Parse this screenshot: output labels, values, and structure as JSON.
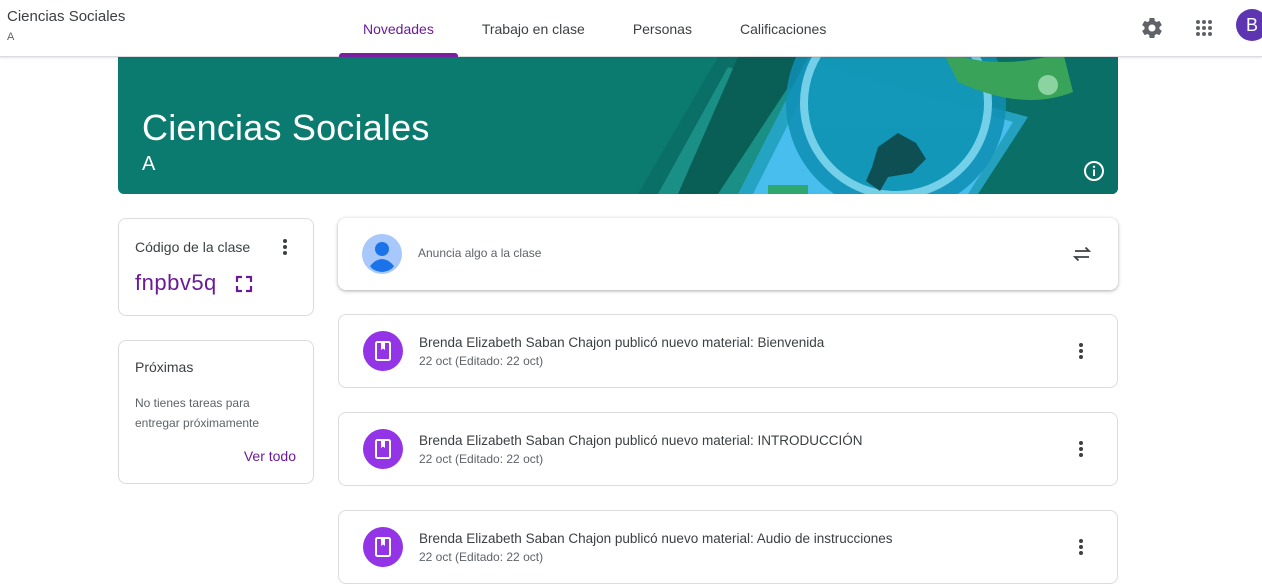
{
  "header": {
    "class_name": "Ciencias Sociales",
    "section": "A",
    "tabs": [
      {
        "label": "Novedades",
        "active": true
      },
      {
        "label": "Trabajo en clase",
        "active": false
      },
      {
        "label": "Personas",
        "active": false
      },
      {
        "label": "Calificaciones",
        "active": false
      }
    ],
    "icons": [
      "settings-icon",
      "apps-grid-icon"
    ],
    "avatar_letter": "B"
  },
  "banner": {
    "title": "Ciencias Sociales",
    "section": "A",
    "color": "#0b7a6f"
  },
  "class_code": {
    "label": "Código de la clase",
    "code": "fnpbv5q"
  },
  "upcoming": {
    "title": "Próximas",
    "text": "No tienes tareas para entregar próximamente",
    "view_all": "Ver todo"
  },
  "announce": {
    "placeholder": "Anuncia algo a la clase"
  },
  "posts": [
    {
      "title": "Brenda Elizabeth Saban Chajon publicó nuevo material: Bienvenida",
      "date": "22 oct (Editado: 22 oct)"
    },
    {
      "title": "Brenda Elizabeth Saban Chajon publicó nuevo material: INTRODUCCIÓN",
      "date": "22 oct (Editado: 22 oct)"
    },
    {
      "title": "Brenda Elizabeth Saban Chajon publicó nuevo material: Audio de instrucciones",
      "date": "22 oct (Editado: 22 oct)"
    }
  ],
  "colors": {
    "accent": "#6a1b9a",
    "post_icon": "#9334e6"
  }
}
